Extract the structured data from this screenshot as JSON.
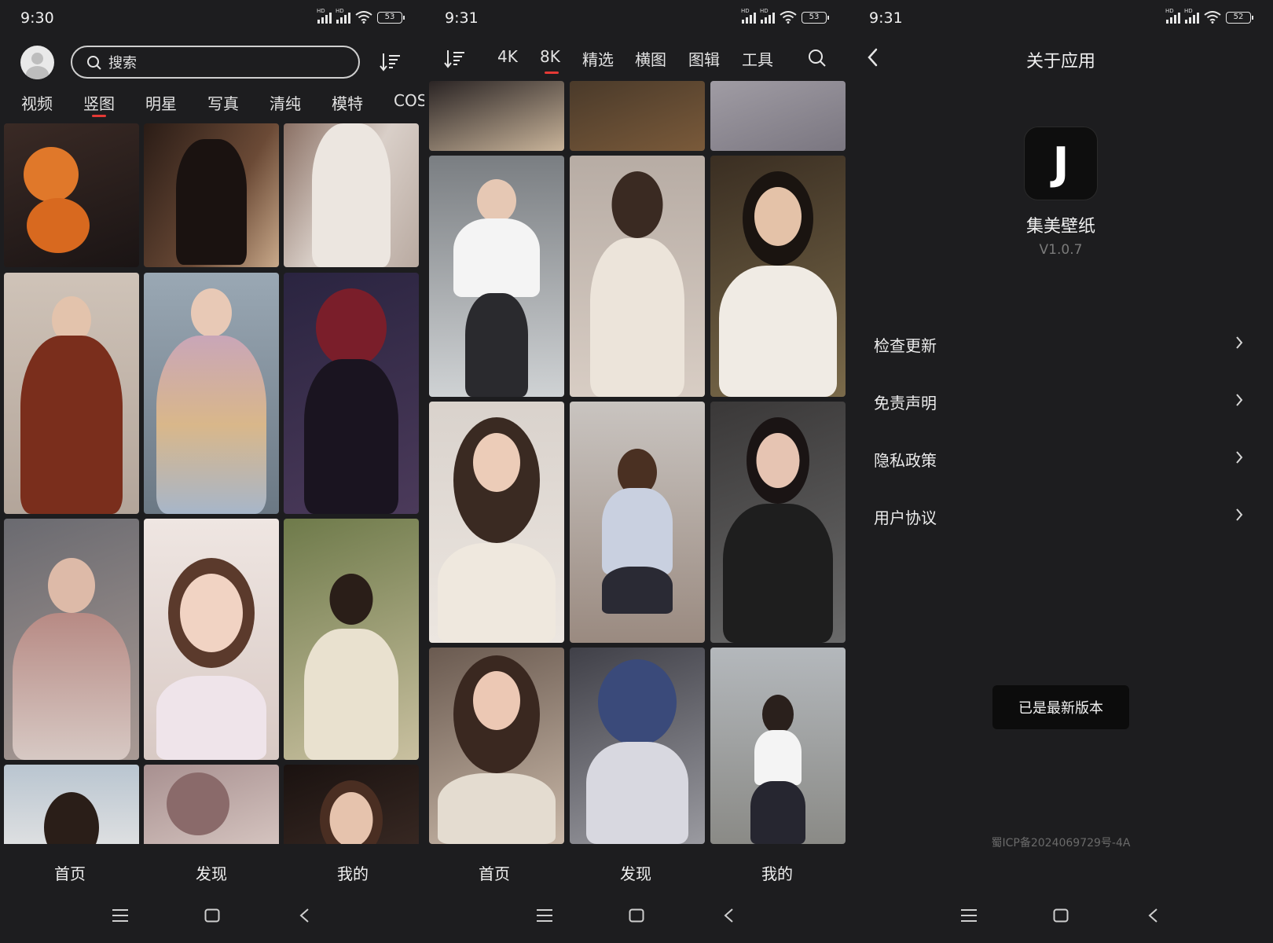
{
  "panels": {
    "home": {
      "status": {
        "time": "9:30",
        "battery": "53"
      },
      "search": {
        "placeholder": "搜索"
      },
      "tabs": [
        "视频",
        "竖图",
        "明星",
        "写真",
        "清纯",
        "模特",
        "COS"
      ],
      "active_tab_index": 1,
      "bottom_nav": [
        "首页",
        "发现",
        "我的"
      ]
    },
    "discover": {
      "status": {
        "time": "9:31",
        "battery": "53"
      },
      "tabs": [
        "4K",
        "8K",
        "精选",
        "横图",
        "图辑",
        "工具"
      ],
      "active_tab_index": 1,
      "bottom_nav": [
        "首页",
        "发现",
        "我的"
      ]
    },
    "about": {
      "status": {
        "time": "9:31",
        "battery": "52"
      },
      "title": "关于应用",
      "logo_letter": "J",
      "app_name": "集美壁纸",
      "version": "V1.0.7",
      "menu": [
        "检查更新",
        "免责声明",
        "隐私政策",
        "用户协议"
      ],
      "latest_button": "已是最新版本",
      "icp": "蜀ICP备2024069729号-4A"
    }
  },
  "colors": {
    "background": "#1d1d1f",
    "accent_underline": "#e53935",
    "text": "#e8e8e8",
    "muted": "#7a7a7a"
  },
  "icons": {
    "sort": "sort-icon",
    "search": "search-icon",
    "back": "back-icon",
    "chevron": "chevron-right-icon",
    "sysnav": [
      "menu-icon",
      "home-square-icon",
      "back-triangle-icon"
    ]
  }
}
